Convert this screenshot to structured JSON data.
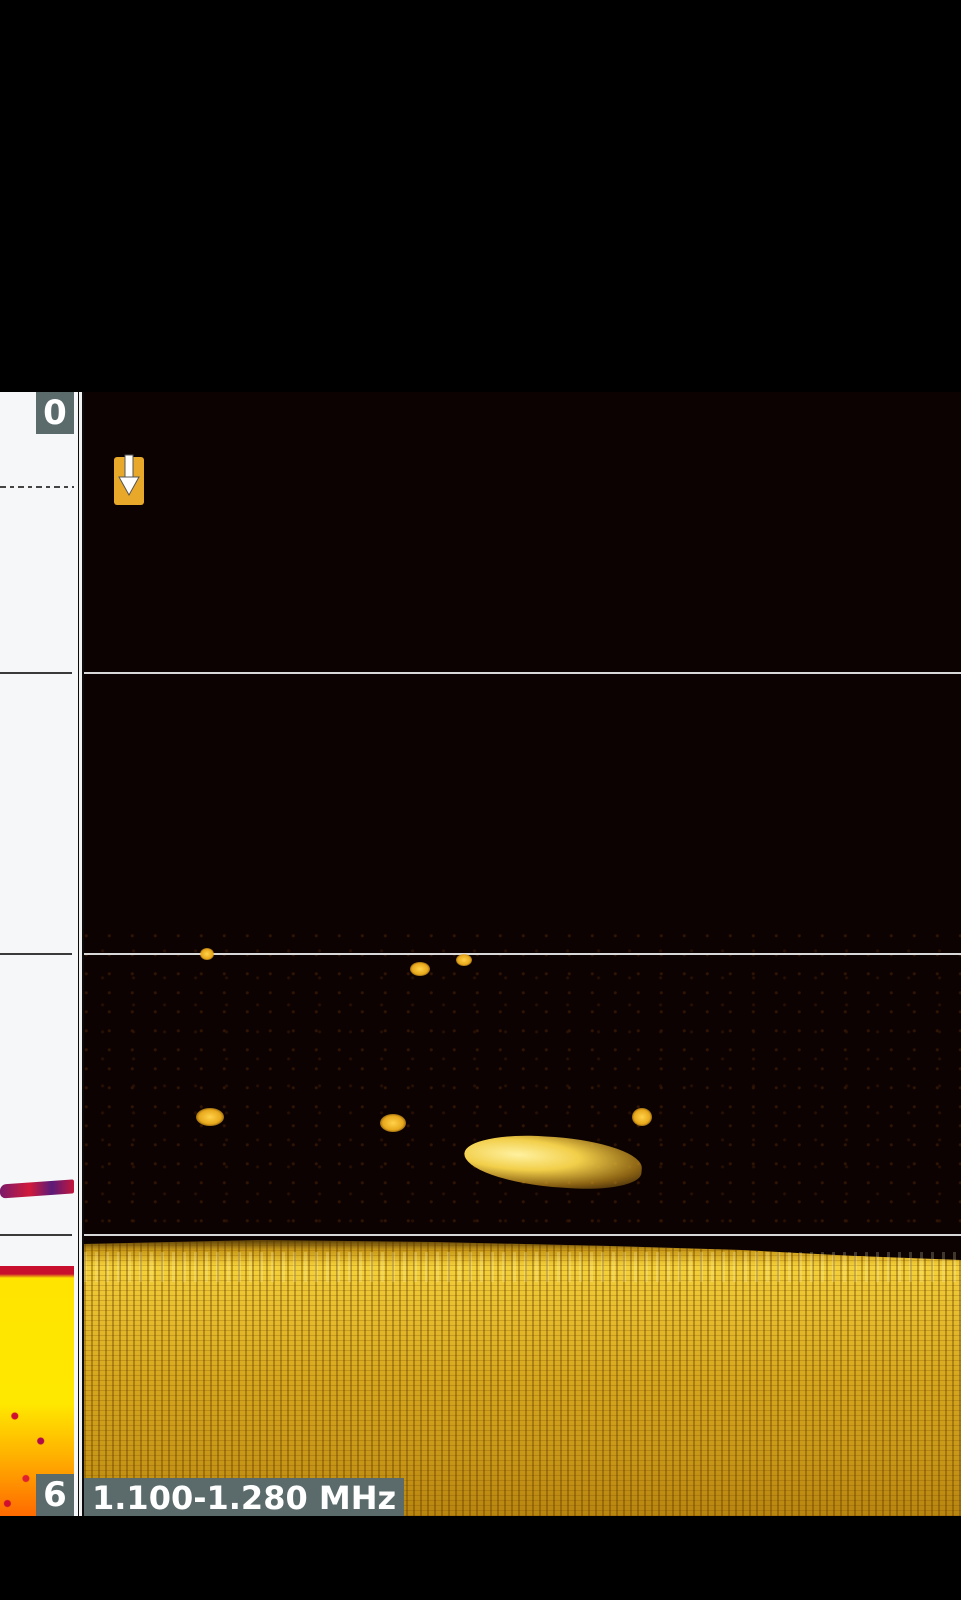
{
  "sonar": {
    "depth_scale": {
      "top": "0",
      "bottom": "6"
    },
    "frequency_label": "1.100-1.280 MHz",
    "marker_icon": "down-arrow-icon",
    "colors": {
      "imaging_palette": "#e8a829",
      "label_background": "#5b6b6b",
      "grid_line": "#d8d8d8"
    }
  }
}
